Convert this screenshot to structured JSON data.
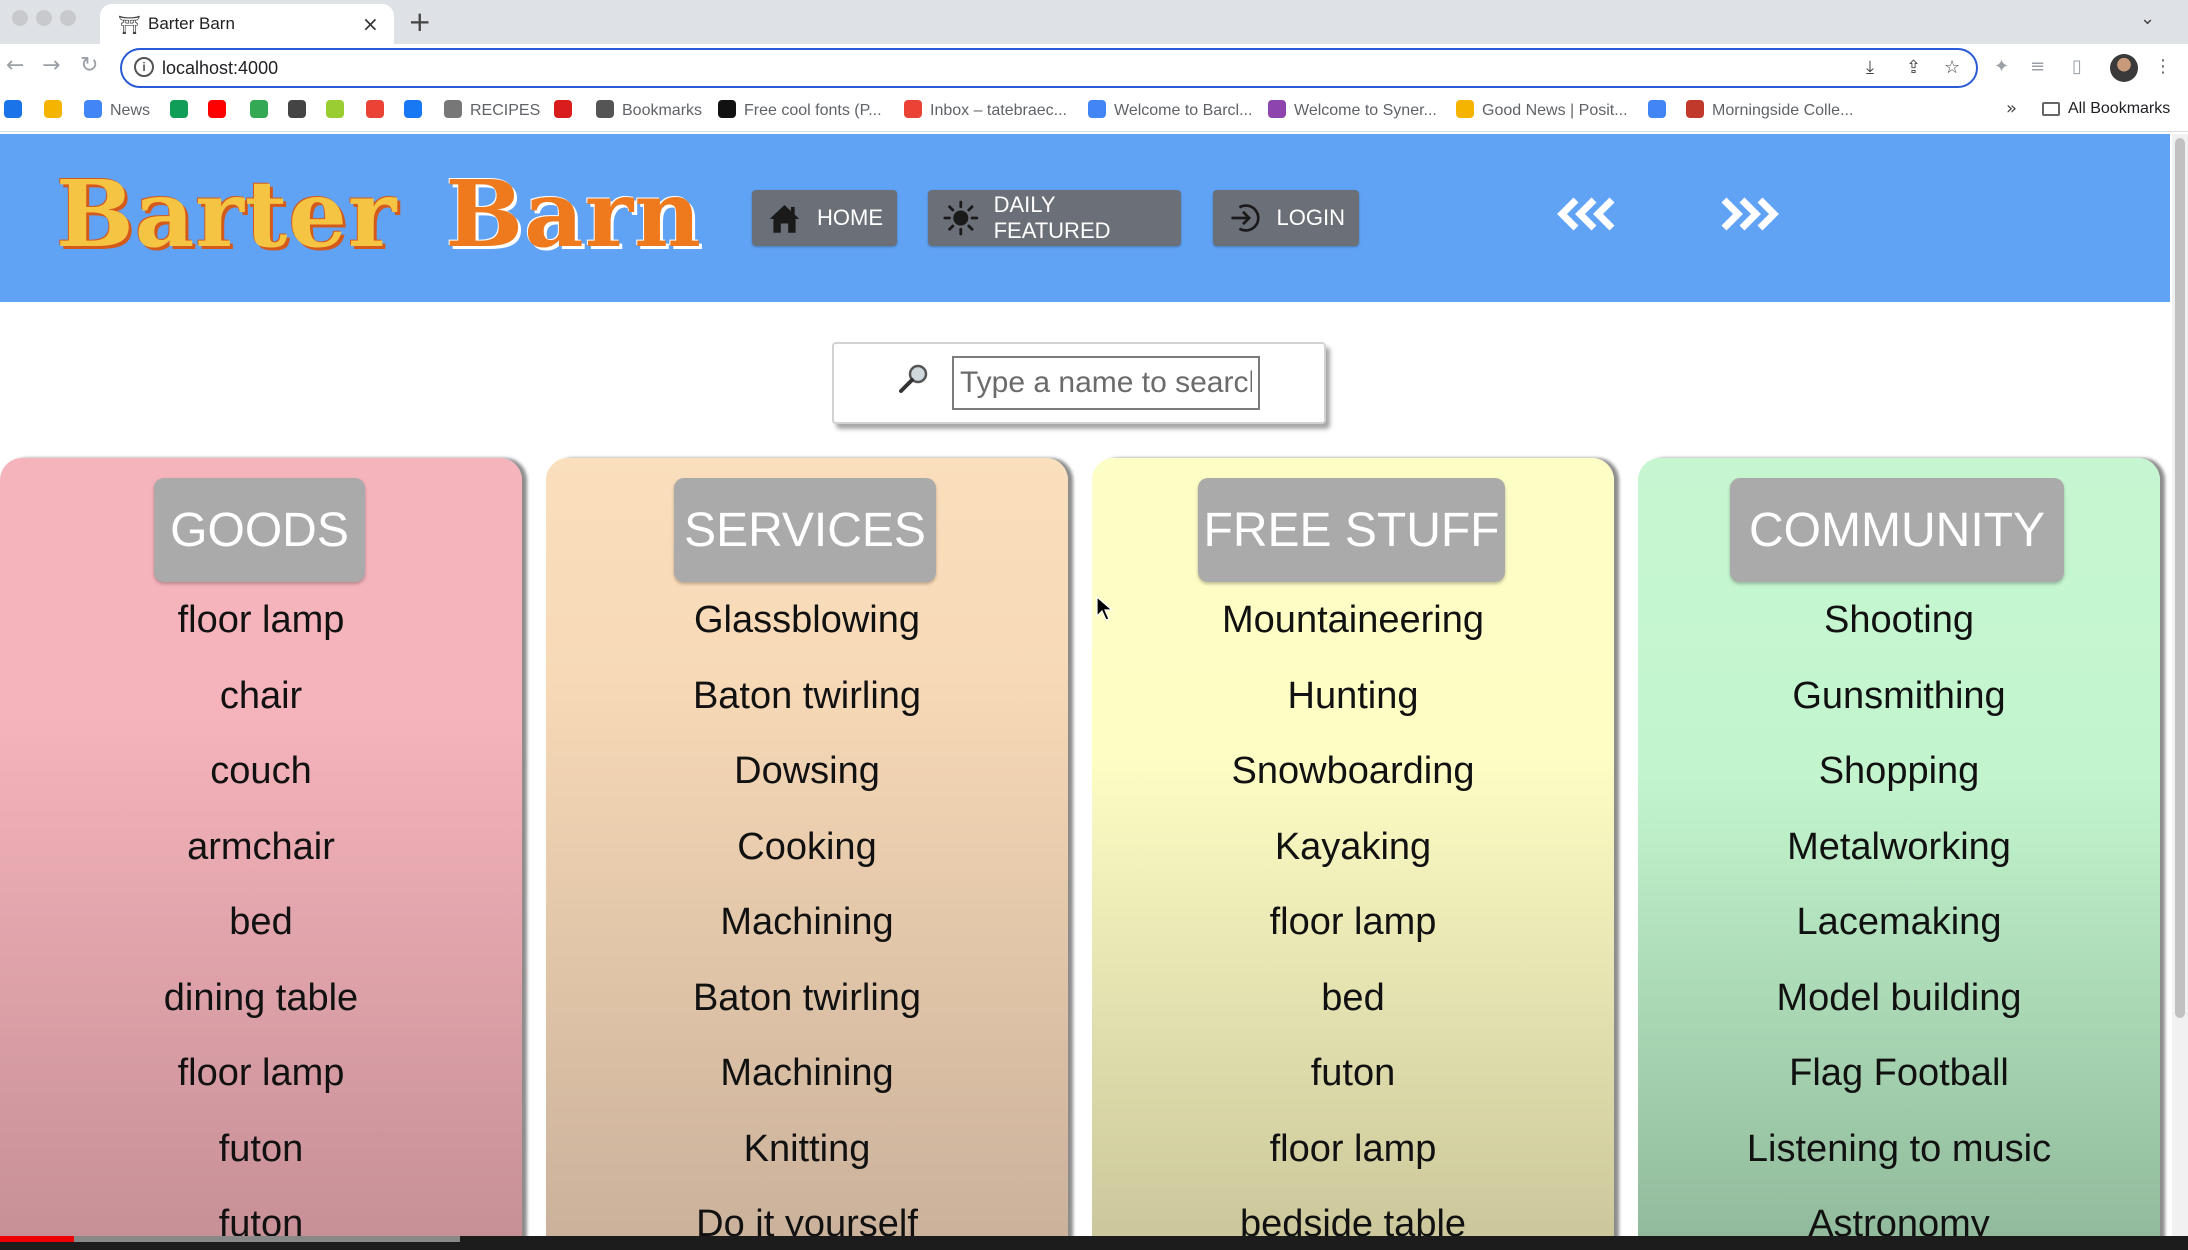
{
  "browser": {
    "tab_title": "Barter Barn",
    "url": "localhost:4000",
    "bookmarks": [
      {
        "label": "",
        "color": "#1a73e8"
      },
      {
        "label": "",
        "color": "#f4b400"
      },
      {
        "label": "News",
        "color": "#4285f4"
      },
      {
        "label": "",
        "color": "#0f9d58"
      },
      {
        "label": "",
        "color": "#ff0000"
      },
      {
        "label": "",
        "color": "#34a853"
      },
      {
        "label": "",
        "color": "#444444"
      },
      {
        "label": "",
        "color": "#9acd32"
      },
      {
        "label": "",
        "color": "#ea4335"
      },
      {
        "label": "",
        "color": "#1877f2"
      },
      {
        "label": "RECIPES",
        "color": "#777777"
      },
      {
        "label": "",
        "color": "#d91c1c"
      },
      {
        "label": "Bookmarks",
        "color": "#555555"
      },
      {
        "label": "Free cool fonts (P...",
        "color": "#111111"
      },
      {
        "label": "Inbox – tatebraec...",
        "color": "#ea4335"
      },
      {
        "label": "Welcome to Barcl...",
        "color": "#4285f4"
      },
      {
        "label": "Welcome to Syner...",
        "color": "#8e44ad"
      },
      {
        "label": "Good News | Posit...",
        "color": "#f4b400"
      },
      {
        "label": "",
        "color": "#4285f4"
      },
      {
        "label": "Morningside Colle...",
        "color": "#c0392b"
      }
    ],
    "all_bookmarks": "All Bookmarks"
  },
  "header": {
    "logo_word1": "Barter",
    "logo_word2": "Barn",
    "nav": {
      "home": "HOME",
      "daily_featured": "DAILY FEATURED",
      "login": "LOGIN"
    },
    "prev_arrow": "«‹",
    "next_arrow": "›»"
  },
  "search": {
    "placeholder": "Type a name to search.."
  },
  "columns": [
    {
      "title": "GOODS",
      "items": [
        "floor lamp",
        "chair",
        "couch",
        "armchair",
        "bed",
        "dining table",
        "floor lamp",
        "futon",
        "futon"
      ]
    },
    {
      "title": "SERVICES",
      "items": [
        "Glassblowing",
        "Baton twirling",
        "Dowsing",
        "Cooking",
        "Machining",
        "Baton twirling",
        "Machining",
        "Knitting",
        "Do it yourself"
      ]
    },
    {
      "title": "FREE STUFF",
      "items": [
        "Mountaineering",
        "Hunting",
        "Snowboarding",
        "Kayaking",
        "floor lamp",
        "bed",
        "futon",
        "floor lamp",
        "bedside table"
      ]
    },
    {
      "title": "COMMUNITY",
      "items": [
        "Shooting",
        "Gunsmithing",
        "Shopping",
        "Metalworking",
        "Lacemaking",
        "Model building",
        "Flag Football",
        "Listening to music",
        "Astronomy"
      ]
    }
  ],
  "colors": {
    "header_bg": "#60a2f3",
    "goods": "#f5b3bb",
    "services": "#fadfbd",
    "free_stuff": "#fdfdc6",
    "community": "#c6f6d1"
  }
}
